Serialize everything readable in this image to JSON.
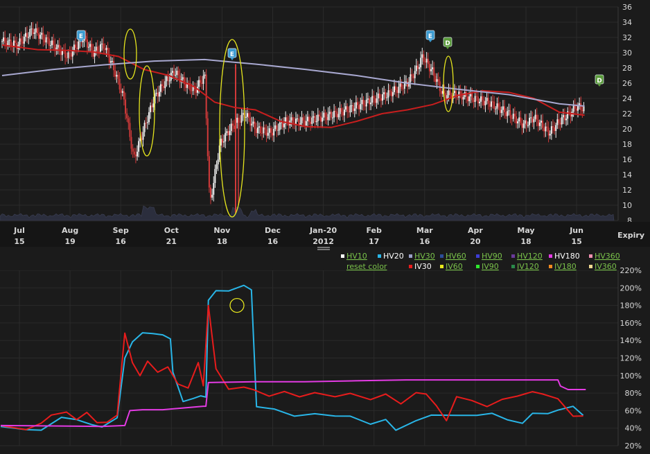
{
  "price_panel": {
    "yaxis_ticks": [
      "36",
      "34",
      "32",
      "30",
      "28",
      "26",
      "24",
      "22",
      "20",
      "18",
      "16",
      "14",
      "12",
      "10",
      "8"
    ],
    "xaxis": [
      {
        "top": "Jul",
        "bottom": "15"
      },
      {
        "top": "Aug",
        "bottom": "19"
      },
      {
        "top": "Sep",
        "bottom": "16"
      },
      {
        "top": "Oct",
        "bottom": "21"
      },
      {
        "top": "Nov",
        "bottom": "18"
      },
      {
        "top": "Dec",
        "bottom": "16"
      },
      {
        "top": "Jan-20",
        "bottom": "2012"
      },
      {
        "top": "Feb",
        "bottom": "17"
      },
      {
        "top": "Mar",
        "bottom": "16"
      },
      {
        "top": "Apr",
        "bottom": "20"
      },
      {
        "top": "May",
        "bottom": "18"
      },
      {
        "top": "Jun",
        "bottom": "15"
      }
    ],
    "expiry_label": "Expiry",
    "event_markers": [
      {
        "letter": "E",
        "kind": "earnings"
      },
      {
        "letter": "E",
        "kind": "earnings"
      },
      {
        "letter": "E",
        "kind": "earnings"
      },
      {
        "letter": "D",
        "kind": "dividend"
      },
      {
        "letter": "D",
        "kind": "dividend"
      }
    ]
  },
  "legend": {
    "row1": [
      {
        "label": "HV10",
        "color": "#ffffff",
        "active": false
      },
      {
        "label": "HV20",
        "color": "#29b6e8",
        "active": true
      },
      {
        "label": "HV30",
        "color": "#9aa0c8",
        "active": false
      },
      {
        "label": "HV60",
        "color": "#2c4e9a",
        "active": false
      },
      {
        "label": "HV90",
        "color": "#3d3dd6",
        "active": false
      },
      {
        "label": "HV120",
        "color": "#6a3a9a",
        "active": false
      },
      {
        "label": "HV180",
        "color": "#e43be4",
        "active": true
      },
      {
        "label": "HV360",
        "color": "#f090b0",
        "active": false
      }
    ],
    "row2": [
      {
        "label": "IV30",
        "color": "#e81c1c",
        "active": true
      },
      {
        "label": "IV60",
        "color": "#e8e81c",
        "active": false
      },
      {
        "label": "IV90",
        "color": "#2ee82e",
        "active": false
      },
      {
        "label": "IV120",
        "color": "#2a8a4a",
        "active": false
      },
      {
        "label": "IV180",
        "color": "#f08a20",
        "active": false
      },
      {
        "label": "IV360",
        "color": "#f0d890",
        "active": false
      }
    ],
    "reset_label": "reset color"
  },
  "vol_panel": {
    "yaxis_ticks": [
      "220%",
      "200%",
      "180%",
      "160%",
      "140%",
      "120%",
      "100%",
      "80%",
      "60%",
      "40%",
      "20%"
    ]
  },
  "colors": {
    "bg": "#1b1b1b",
    "grid": "#2b2b2b",
    "candle_up": "#f2f2f2",
    "candle_down": "#d23a3a",
    "ma_short": "#c81e1e",
    "ma_long": "#a8a8d0",
    "volume": "#2b2e3d",
    "highlight": "#e6e61e",
    "earnings": "#3a9ad0",
    "dividend": "#5a9a3a",
    "link": "#7ac24a"
  },
  "chart_data": [
    {
      "type": "candlestick",
      "title": "",
      "ylim": [
        8,
        36
      ],
      "x_categories": [
        "Jul 15",
        "Aug 19",
        "Sep 16",
        "Oct 21",
        "Nov 18",
        "Dec 16",
        "Jan-20 2012",
        "Feb 17",
        "Mar 16",
        "Apr 20",
        "May 18",
        "Jun 15"
      ],
      "close_path": [
        [
          0,
          31.5
        ],
        [
          0.3,
          31
        ],
        [
          0.6,
          33
        ],
        [
          1,
          31
        ],
        [
          1.3,
          29.5
        ],
        [
          1.6,
          32
        ],
        [
          1.8,
          30
        ],
        [
          2,
          31
        ],
        [
          2.2,
          28
        ],
        [
          2.4,
          24
        ],
        [
          2.6,
          16
        ],
        [
          2.8,
          20
        ],
        [
          3,
          24
        ],
        [
          3.2,
          26
        ],
        [
          3.4,
          27.5
        ],
        [
          3.6,
          26
        ],
        [
          3.8,
          25
        ],
        [
          4,
          27
        ],
        [
          4.1,
          10
        ],
        [
          4.3,
          18
        ],
        [
          4.5,
          20
        ],
        [
          4.8,
          22
        ],
        [
          5,
          20
        ],
        [
          5.3,
          19.5
        ],
        [
          5.6,
          21
        ],
        [
          6,
          21
        ],
        [
          6.3,
          21.5
        ],
        [
          6.6,
          22
        ],
        [
          7,
          23
        ],
        [
          7.3,
          23.8
        ],
        [
          7.6,
          24.5
        ],
        [
          8,
          26
        ],
        [
          8.2,
          28
        ],
        [
          8.3,
          29.5
        ],
        [
          8.5,
          27.5
        ],
        [
          8.7,
          24.5
        ],
        [
          9,
          24.5
        ],
        [
          9.3,
          24
        ],
        [
          9.6,
          23.5
        ],
        [
          10,
          22
        ],
        [
          10.3,
          20.5
        ],
        [
          10.5,
          21.5
        ],
        [
          10.8,
          19.5
        ],
        [
          11,
          21
        ],
        [
          11.2,
          22
        ],
        [
          11.35,
          23
        ],
        [
          11.5,
          22.6
        ]
      ],
      "series": [
        {
          "name": "",
          "role": "short moving average",
          "points": [
            [
              0,
              31
            ],
            [
              0.7,
              30.4
            ],
            [
              1.3,
              30.3
            ],
            [
              1.8,
              30.1
            ],
            [
              2.3,
              29.5
            ],
            [
              2.8,
              27.8
            ],
            [
              3.3,
              27
            ],
            [
              3.8,
              25.5
            ],
            [
              4.2,
              23.5
            ],
            [
              4.6,
              22.8
            ],
            [
              5,
              22.5
            ],
            [
              5.5,
              21
            ],
            [
              6,
              20.3
            ],
            [
              6.5,
              20.2
            ],
            [
              7,
              21
            ],
            [
              7.5,
              22
            ],
            [
              8,
              22.5
            ],
            [
              8.5,
              23.2
            ],
            [
              9,
              24.4
            ],
            [
              9.5,
              25
            ],
            [
              10,
              24.8
            ],
            [
              10.5,
              24
            ],
            [
              11,
              22.2
            ],
            [
              11.5,
              21.8
            ]
          ]
        },
        {
          "name": "",
          "role": "long moving average",
          "points": [
            [
              0,
              27
            ],
            [
              1,
              27.8
            ],
            [
              2,
              28.4
            ],
            [
              3,
              28.9
            ],
            [
              4,
              29.1
            ],
            [
              4.5,
              28.8
            ],
            [
              5,
              28.5
            ],
            [
              6,
              27.8
            ],
            [
              7,
              27
            ],
            [
              8,
              26
            ],
            [
              9,
              25.2
            ],
            [
              10,
              24.5
            ],
            [
              11,
              23.3
            ],
            [
              11.5,
              23
            ]
          ]
        }
      ],
      "annotations": [
        "E",
        "E",
        "E",
        "D",
        "D"
      ]
    },
    {
      "type": "line",
      "title": "",
      "ylim": [
        20,
        220
      ],
      "yunit": "%",
      "series": [
        {
          "name": "HV20",
          "color": "#29b6e8",
          "points": [
            [
              0,
              42
            ],
            [
              0.5,
              40
            ],
            [
              0.8,
              36
            ],
            [
              1,
              45
            ],
            [
              1.2,
              54
            ],
            [
              1.5,
              48
            ],
            [
              1.8,
              44
            ],
            [
              2,
              43
            ],
            [
              2.3,
              50
            ],
            [
              2.45,
              120
            ],
            [
              2.6,
              140
            ],
            [
              2.8,
              147
            ],
            [
              3,
              148
            ],
            [
              3.2,
              148
            ],
            [
              3.35,
              140
            ],
            [
              3.4,
              104
            ],
            [
              3.6,
              72
            ],
            [
              3.8,
              72
            ],
            [
              3.95,
              77
            ],
            [
              4.05,
              77
            ],
            [
              4.1,
              184
            ],
            [
              4.25,
              197
            ],
            [
              4.5,
              198
            ],
            [
              4.8,
              201
            ],
            [
              4.95,
              198
            ],
            [
              5.05,
              66
            ],
            [
              5.4,
              60
            ],
            [
              5.8,
              54
            ],
            [
              6.2,
              58
            ],
            [
              6.6,
              52
            ],
            [
              6.9,
              54
            ],
            [
              7.3,
              46
            ],
            [
              7.6,
              48
            ],
            [
              7.8,
              38
            ],
            [
              8.2,
              50
            ],
            [
              8.5,
              53
            ],
            [
              9,
              55
            ],
            [
              9.4,
              56
            ],
            [
              9.7,
              55
            ],
            [
              10,
              50
            ],
            [
              10.3,
              47
            ],
            [
              10.5,
              55
            ],
            [
              10.8,
              57
            ],
            [
              11,
              62
            ],
            [
              11.3,
              63
            ],
            [
              11.5,
              55
            ]
          ]
        },
        {
          "name": "IV30",
          "color": "#e81c1c",
          "points": [
            [
              0,
              43
            ],
            [
              0.5,
              40
            ],
            [
              0.8,
              44
            ],
            [
              1,
              55
            ],
            [
              1.3,
              60
            ],
            [
              1.5,
              48
            ],
            [
              1.7,
              58
            ],
            [
              1.9,
              48
            ],
            [
              2.1,
              45
            ],
            [
              2.3,
              55
            ],
            [
              2.45,
              150
            ],
            [
              2.6,
              113
            ],
            [
              2.75,
              100
            ],
            [
              2.9,
              118
            ],
            [
              3.1,
              102
            ],
            [
              3.3,
              110
            ],
            [
              3.5,
              92
            ],
            [
              3.7,
              84
            ],
            [
              3.9,
              115
            ],
            [
              4.0,
              90
            ],
            [
              4.1,
              178
            ],
            [
              4.25,
              108
            ],
            [
              4.5,
              86
            ],
            [
              4.8,
              85
            ],
            [
              5,
              84
            ],
            [
              5.3,
              78
            ],
            [
              5.6,
              80
            ],
            [
              5.9,
              76
            ],
            [
              6.2,
              82
            ],
            [
              6.6,
              74
            ],
            [
              6.9,
              80
            ],
            [
              7.3,
              74
            ],
            [
              7.6,
              77
            ],
            [
              7.9,
              68
            ],
            [
              8.2,
              82
            ],
            [
              8.4,
              77
            ],
            [
              8.6,
              66
            ],
            [
              8.8,
              50
            ],
            [
              9,
              74
            ],
            [
              9.3,
              72
            ],
            [
              9.6,
              66
            ],
            [
              9.9,
              71
            ],
            [
              10.2,
              77
            ],
            [
              10.5,
              83
            ],
            [
              10.7,
              77
            ],
            [
              11,
              74
            ],
            [
              11.3,
              55
            ],
            [
              11.5,
              52
            ]
          ]
        },
        {
          "name": "HV180",
          "color": "#e43be4",
          "points": [
            [
              0,
              43
            ],
            [
              2,
              42
            ],
            [
              2.45,
              43
            ],
            [
              2.55,
              60
            ],
            [
              2.8,
              61
            ],
            [
              3.2,
              61
            ],
            [
              3.6,
              63
            ],
            [
              4,
              65
            ],
            [
              4.05,
              65
            ],
            [
              4.1,
              92
            ],
            [
              5,
              93
            ],
            [
              6,
              93
            ],
            [
              7,
              94
            ],
            [
              8,
              95
            ],
            [
              9,
              95
            ],
            [
              10,
              95
            ],
            [
              11,
              95
            ],
            [
              11.05,
              88
            ],
            [
              11.2,
              84
            ],
            [
              11.55,
              84
            ]
          ]
        }
      ]
    }
  ]
}
